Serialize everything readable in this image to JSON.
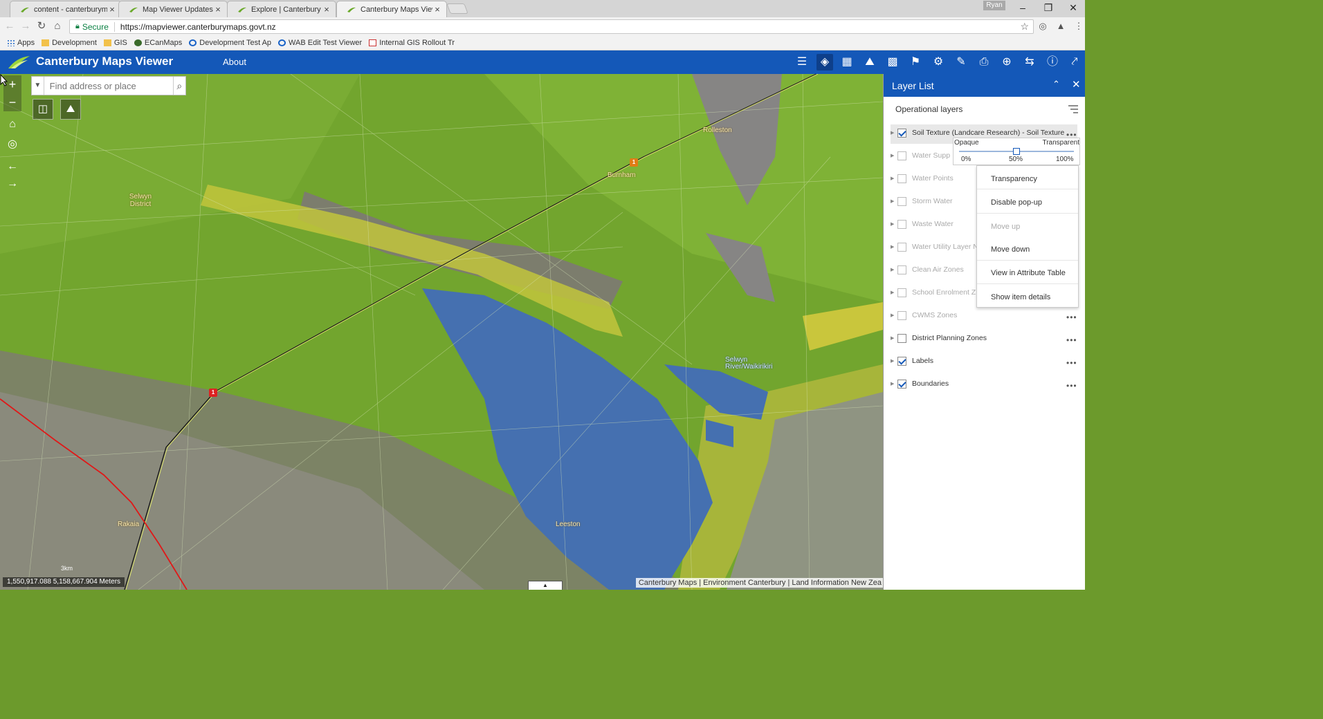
{
  "browser": {
    "tabs": [
      {
        "label": "content - canterburymap",
        "active": false
      },
      {
        "label": "Map Viewer Updates | Ca",
        "active": false
      },
      {
        "label": "Explore | Canterbury Ma",
        "active": false
      },
      {
        "label": "Canterbury Maps Viewer",
        "active": true
      }
    ],
    "profile_name": "Ryan",
    "secure_label": "Secure",
    "url": "https://mapviewer.canterburymaps.govt.nz",
    "bookmarks": [
      "Apps",
      "Development",
      "GIS",
      "ECanMaps",
      "Development Test Ap",
      "WAB Edit Test Viewer",
      "Internal GIS Rollout Tr"
    ]
  },
  "app": {
    "title": "Canterbury Maps Viewer",
    "about_label": "About",
    "header_icons": [
      "layer-list-icon",
      "layers-icon",
      "basemap-icon",
      "analysis-icon",
      "grid-icon",
      "query-icon",
      "filter-icon",
      "measure-icon",
      "print-icon",
      "locate-icon",
      "swipe-icon",
      "info-icon",
      "share-icon"
    ],
    "brand_color": "#1458b8"
  },
  "map": {
    "search_placeholder": "Find address or place",
    "labels": {
      "selwyn_district": "Selwyn District",
      "rolleston": "Rolleston",
      "burnham": "Burnham",
      "leeston": "Leeston",
      "rakaia": "Rakaia",
      "lake": "Selwyn River/Waikirikiri"
    },
    "road_shield": "1",
    "coordinates": "1,550,917.088 5,158,667.904 Meters",
    "scale": "3km",
    "attribution": "Canterbury Maps | Environment Canterbury | Land Information New Zea"
  },
  "layer_list": {
    "title": "Layer List",
    "section_label": "Operational layers",
    "layers": [
      {
        "name": "Soil Texture (Landcare Research) - Soil Texture",
        "checked": true
      },
      {
        "name": "Water Supp",
        "checked": false
      },
      {
        "name": "Water Points",
        "checked": false
      },
      {
        "name": "Storm Water",
        "checked": false
      },
      {
        "name": "Waste Water",
        "checked": false
      },
      {
        "name": "Water Utility Layer N",
        "checked": false
      },
      {
        "name": "Clean Air Zones",
        "checked": false
      },
      {
        "name": "School Enrolment Z",
        "checked": false
      },
      {
        "name": "CWMS Zones",
        "checked": false
      },
      {
        "name": "District Planning Zones",
        "checked": false
      },
      {
        "name": "Labels",
        "checked": true
      },
      {
        "name": "Boundaries",
        "checked": true
      }
    ],
    "transparency": {
      "opaque_label": "Opaque",
      "transparent_label": "Transparent",
      "ticks": [
        "0%",
        "50%",
        "100%"
      ],
      "value_percent": 50
    },
    "menu": [
      {
        "label": "Transparency",
        "enabled": true
      },
      {
        "label": "Disable pop-up",
        "enabled": true
      },
      {
        "label": "Move up",
        "enabled": false
      },
      {
        "label": "Move down",
        "enabled": true
      },
      {
        "label": "View in Attribute Table",
        "enabled": true
      },
      {
        "label": "Show item details",
        "enabled": true
      }
    ]
  }
}
